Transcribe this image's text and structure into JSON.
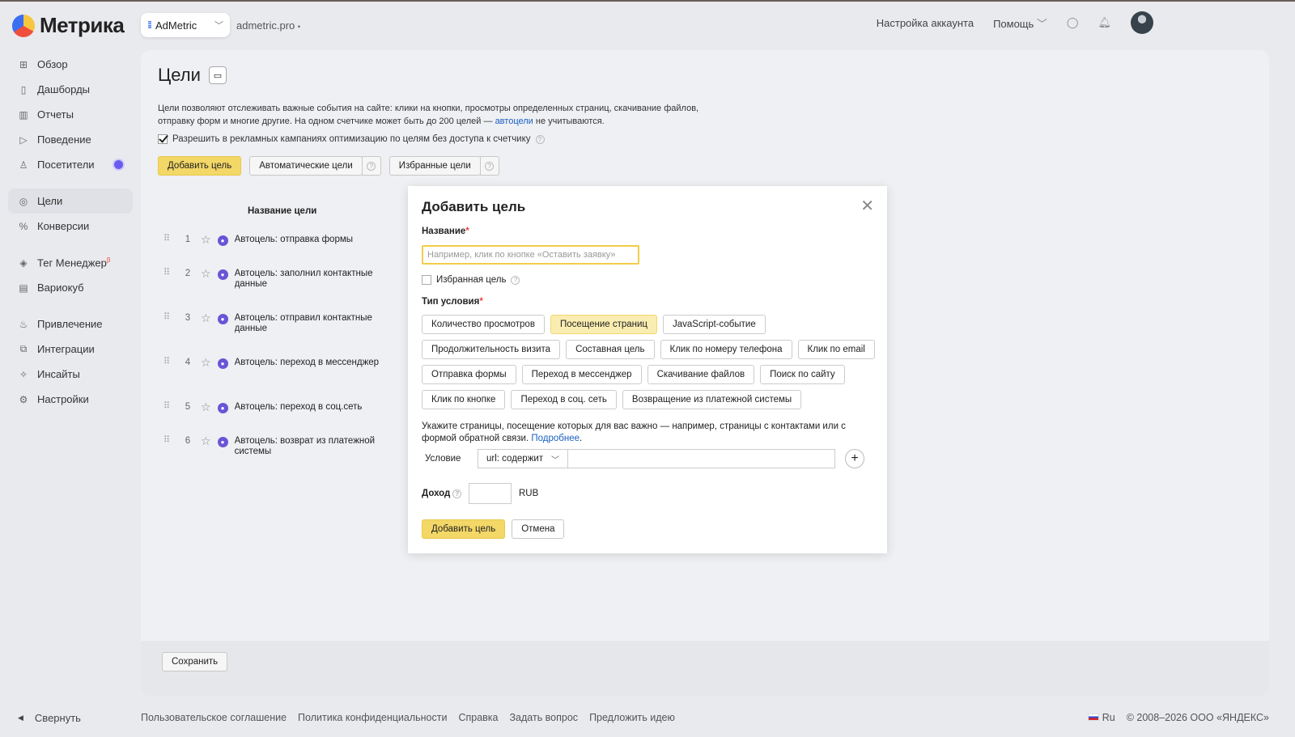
{
  "header": {
    "logo": "Метрика",
    "counter": "AdMetric",
    "domain": "admetric.pro",
    "domain_dot": "•",
    "account_settings": "Настройка аккаунта",
    "help": "Помощь"
  },
  "sidebar": {
    "items": [
      {
        "label": "Обзор",
        "icon": "grid-icon"
      },
      {
        "label": "Дашборды",
        "icon": "dashboard-icon"
      },
      {
        "label": "Отчеты",
        "icon": "chart-icon"
      },
      {
        "label": "Поведение",
        "icon": "play-icon"
      },
      {
        "label": "Посетители",
        "icon": "user-icon"
      },
      {
        "label": "Цели",
        "icon": "target-icon"
      },
      {
        "label": "Конверсии",
        "icon": "percent-icon"
      },
      {
        "label": "Тег Менеджер",
        "icon": "tag-icon",
        "sup": "β"
      },
      {
        "label": "Вариокуб",
        "icon": "cube-icon"
      },
      {
        "label": "Привлечение",
        "icon": "fire-icon"
      },
      {
        "label": "Интеграции",
        "icon": "puzzle-icon"
      },
      {
        "label": "Инсайты",
        "icon": "sparkle-icon"
      },
      {
        "label": "Настройки",
        "icon": "gear-icon"
      }
    ],
    "collapse": "Свернуть"
  },
  "main": {
    "title": "Цели",
    "desc_1": "Цели позволяют отслеживать важные события на сайте: клики на кнопки, просмотры определенных страниц, скачивание файлов, отправку форм и многие другие. На одном счетчике может быть до 200 целей — ",
    "desc_link": "автоцели",
    "desc_2": " не учитываются.",
    "allow_label": "Разрешить в рекламных кампаниях оптимизацию по целям без доступа к счетчику",
    "add_goal": "Добавить цель",
    "auto_goals": "Автоматические цели",
    "fav_goals": "Избранные цели",
    "col_name": "Название цели",
    "goals": [
      {
        "num": "1",
        "name": "Автоцель: отправка формы"
      },
      {
        "num": "2",
        "name": "Автоцель: заполнил контактные данные"
      },
      {
        "num": "3",
        "name": "Автоцель: отправил контактные данные"
      },
      {
        "num": "4",
        "name": "Автоцель: переход в мессенджер"
      },
      {
        "num": "5",
        "name": "Автоцель: переход в соц.сеть"
      },
      {
        "num": "6",
        "name": "Автоцель: возврат из платежной системы"
      }
    ],
    "save": "Сохранить"
  },
  "footer": {
    "links": [
      "Пользовательское соглашение",
      "Политика конфиденциальности",
      "Справка",
      "Задать вопрос",
      "Предложить идею"
    ],
    "lang": "Ru",
    "copyright": "© 2008–2026 ООО «ЯНДЕКС»"
  },
  "modal": {
    "title": "Добавить цель",
    "name_label": "Название",
    "name_placeholder": "Например, клик по кнопке «Оставить заявку»",
    "favorite_label": "Избранная цель",
    "type_label": "Тип условия",
    "types": [
      "Количество просмотров",
      "Посещение страниц",
      "JavaScript-событие",
      "Продолжительность визита",
      "Составная цель",
      "Клик по номеру телефона",
      "Клик по email",
      "Отправка формы",
      "Переход в мессенджер",
      "Скачивание файлов",
      "Поиск по сайту",
      "Клик по кнопке",
      "Переход в соц. сеть",
      "Возвращение из платежной системы"
    ],
    "selected_type": "Посещение страниц",
    "hint": "Укажите страницы, посещение которых для вас важно — например, страницы с контактами или с формой обратной связи. ",
    "hint_link": "Подробнее",
    "hint_end": ".",
    "condition_label": "Условие",
    "condition_value": "url: содержит",
    "income_label": "Доход",
    "currency": "RUB",
    "submit": "Добавить цель",
    "cancel": "Отмена"
  },
  "colors": {
    "accent": "#f3d767",
    "link": "#1a5fc4",
    "selected": "#faedb1"
  }
}
